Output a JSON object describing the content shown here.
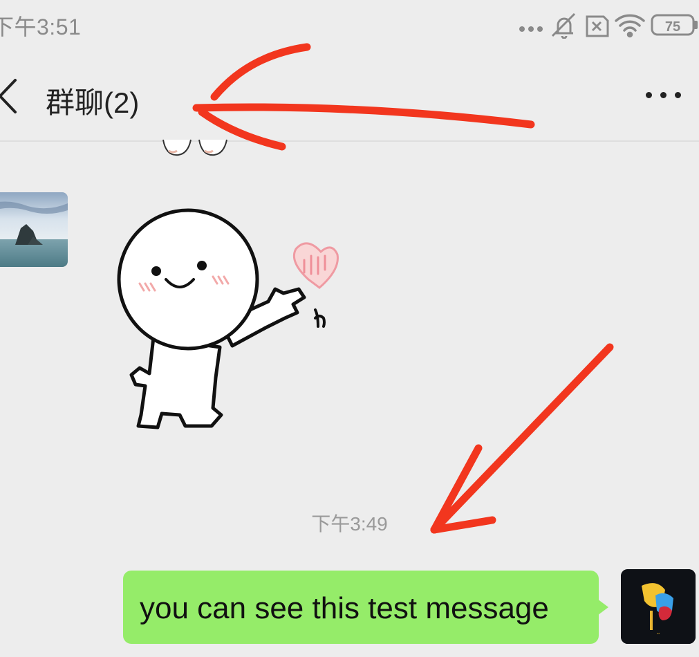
{
  "status_bar": {
    "time": "下午3:51",
    "battery": "75"
  },
  "nav": {
    "title": "群聊(2)"
  },
  "chat": {
    "timestamp": "下午3:49",
    "outgoing_message": "you can see this test message"
  },
  "colors": {
    "background": "#ededed",
    "bubble_green": "#95ec69",
    "annotation_red": "#f2361e"
  },
  "icons": [
    "more-dots-icon",
    "mute-bell-icon",
    "sim-x-icon",
    "wifi-icon",
    "battery-icon",
    "back-arrow-icon"
  ]
}
